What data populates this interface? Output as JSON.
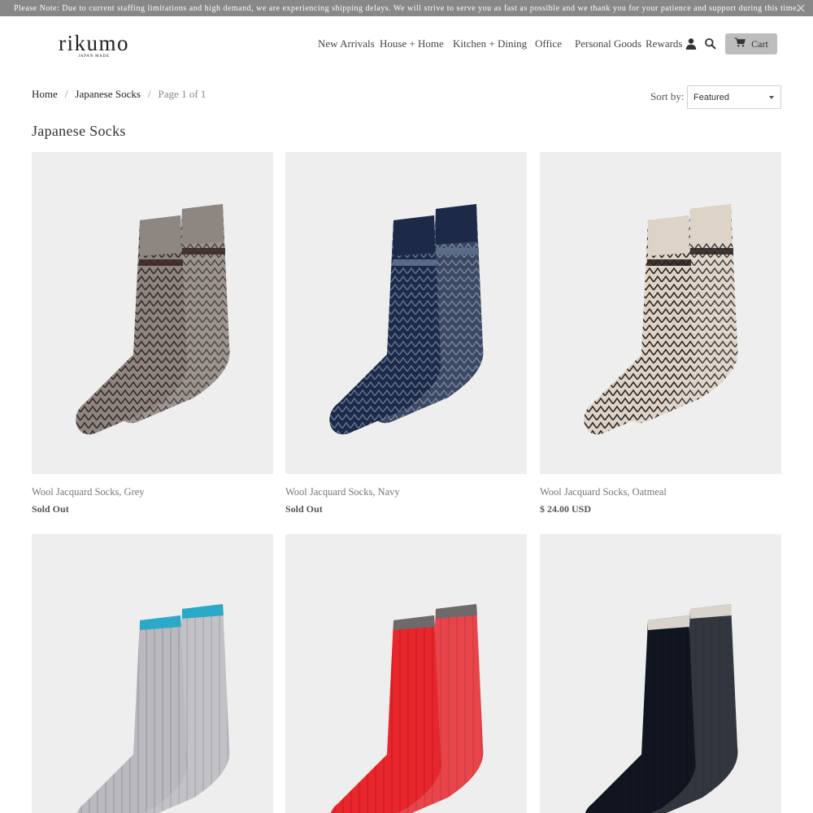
{
  "announcement": {
    "text": "Please Note: Due to current staffing limitations and high demand, we are experiencing shipping delays. We will strive to serve you as fast as possible and we thank you for your patience and support during this time."
  },
  "logo": {
    "main": "rikumo",
    "sub": "JAPAN MADE"
  },
  "nav": {
    "items": [
      "New Arrivals",
      "House + Home",
      "Kitchen + Dining",
      "Office",
      "Personal Goods",
      "Rewards"
    ],
    "cart_label": "Cart"
  },
  "breadcrumb": {
    "home": "Home",
    "collection": "Japanese Socks",
    "page": "Page 1 of 1",
    "separator": "/"
  },
  "sort": {
    "label": "Sort by:",
    "selected": "Featured"
  },
  "page_title": "Japanese Socks",
  "colors": {
    "announcement_bg": "#888888",
    "cart_button_bg": "#bdbdbd",
    "image_bg": "#eeeeee"
  },
  "products": [
    {
      "name": "Wool Jacquard Socks, Grey",
      "price": "Sold Out",
      "main_color": "#8d8681",
      "accent_color": "#3b2a2a",
      "trim_color": "#8d8681",
      "style": "jacquard"
    },
    {
      "name": "Wool Jacquard Socks, Navy",
      "price": "Sold Out",
      "main_color": "#1c2a48",
      "accent_color": "#5d6f8c",
      "trim_color": "#1c2a48",
      "style": "jacquard"
    },
    {
      "name": "Wool Jacquard Socks, Oatmeal",
      "price": "$ 24.00 USD",
      "main_color": "#ddd3c6",
      "accent_color": "#2e2424",
      "trim_color": "#ddd3c6",
      "style": "jacquard"
    },
    {
      "name": "",
      "price": "",
      "main_color": "#b9b9bf",
      "accent_color": "#2aa9c9",
      "trim_color": "#2aa9c9",
      "style": "ribbed"
    },
    {
      "name": "",
      "price": "",
      "main_color": "#e8262c",
      "accent_color": "#7a6f6f",
      "trim_color": "#6e6a6a",
      "style": "ribbed"
    },
    {
      "name": "",
      "price": "",
      "main_color": "#111520",
      "accent_color": "#e8e8e8",
      "trim_color": "#d8d4cc",
      "style": "ribbed"
    }
  ]
}
